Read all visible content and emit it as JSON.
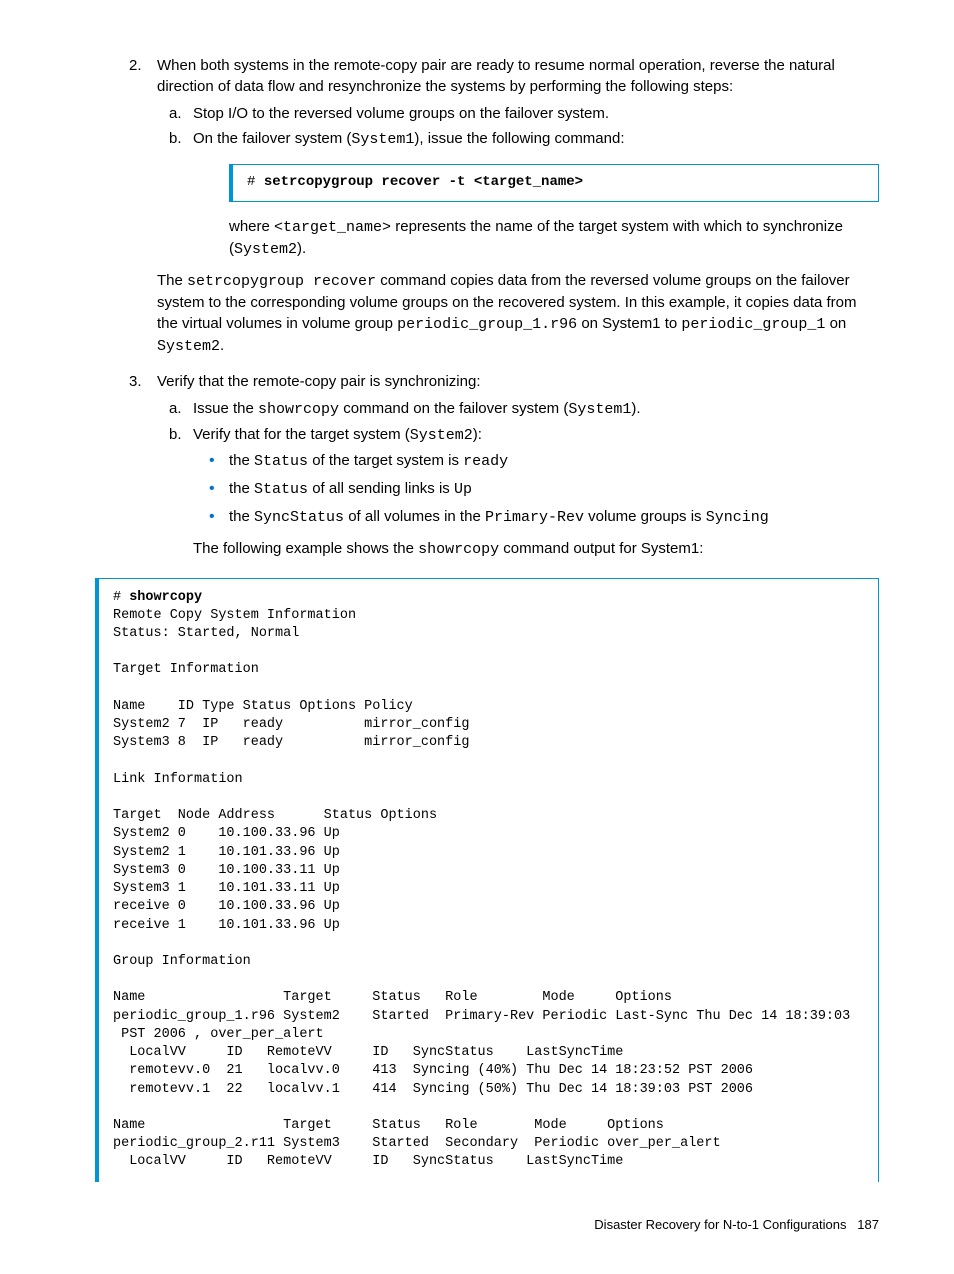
{
  "step2": {
    "num": "2.",
    "text": "When both systems in the remote-copy pair are ready to resume normal operation, reverse the natural direction of data flow and resynchronize the systems by performing the following steps:",
    "a_let": "a.",
    "a_text": "Stop I/O to the reversed volume groups on the failover system.",
    "b_let": "b.",
    "b_pre": "On the failover system (",
    "b_sys": "System1",
    "b_post": "), issue the following command:",
    "cmd_hash": "# ",
    "cmd": "setrcopygroup recover -t <target_name>",
    "where_1": "where ",
    "where_tn": "<target_name>",
    "where_2": " represents the name of the target system with which to synchronize (",
    "where_sys": "System2",
    "where_3": ").",
    "exp_1": "The ",
    "exp_cmd": "setrcopygroup recover",
    "exp_2": " command copies data from the reversed volume groups on the failover system to the corresponding volume groups on the recovered system. In this example, it copies data from the virtual volumes in volume group ",
    "exp_grp": "periodic_group_1.r96",
    "exp_3": " on System1 to ",
    "exp_grp2": "periodic_group_1",
    "exp_4": " on ",
    "exp_sys": "System2",
    "exp_5": "."
  },
  "step3": {
    "num": "3.",
    "text": "Verify that the remote-copy pair is synchronizing:",
    "a_let": "a.",
    "a_1": "Issue the ",
    "a_cmd": "showrcopy",
    "a_2": " command on the failover system (",
    "a_sys": "System1",
    "a_3": ").",
    "b_let": "b.",
    "b_1": "Verify that for the target system (",
    "b_sys": "System2",
    "b_2": "):",
    "bul1_1": "the ",
    "bul1_2": "Status",
    "bul1_3": " of the target system is ",
    "bul1_4": "ready",
    "bul2_1": "the ",
    "bul2_2": "Status",
    "bul2_3": " of all sending links is ",
    "bul2_4": "Up",
    "bul3_1": "the ",
    "bul3_2": "SyncStatus",
    "bul3_3": " of all volumes in the ",
    "bul3_4": "Primary-Rev",
    "bul3_5": " volume groups is ",
    "bul3_6": "Syncing",
    "after_1": "The following example shows the  ",
    "after_cmd": "showrcopy",
    "after_2": " command output for System1:"
  },
  "out_hash": "# ",
  "out_cmd": "showrcopy",
  "out_body": "\nRemote Copy System Information\nStatus: Started, Normal\n\nTarget Information\n\nName    ID Type Status Options Policy\nSystem2 7  IP   ready          mirror_config\nSystem3 8  IP   ready          mirror_config\n\nLink Information\n\nTarget  Node Address      Status Options\nSystem2 0    10.100.33.96 Up\nSystem2 1    10.101.33.96 Up\nSystem3 0    10.100.33.11 Up\nSystem3 1    10.101.33.11 Up\nreceive 0    10.100.33.96 Up\nreceive 1    10.101.33.96 Up\n\nGroup Information\n\nName                 Target     Status   Role        Mode     Options\nperiodic_group_1.r96 System2    Started  Primary-Rev Periodic Last-Sync Thu Dec 14 18:39:03\n PST 2006 , over_per_alert\n  LocalVV     ID   RemoteVV     ID   SyncStatus    LastSyncTime\n  remotevv.0  21   localvv.0    413  Syncing (40%) Thu Dec 14 18:23:52 PST 2006\n  remotevv.1  22   localvv.1    414  Syncing (50%) Thu Dec 14 18:39:03 PST 2006\n\nName                 Target     Status   Role       Mode     Options\nperiodic_group_2.r11 System3    Started  Secondary  Periodic over_per_alert\n  LocalVV     ID   RemoteVV     ID   SyncStatus    LastSyncTime",
  "footer_title": "Disaster Recovery for N-to-1 Configurations",
  "footer_page": "187"
}
